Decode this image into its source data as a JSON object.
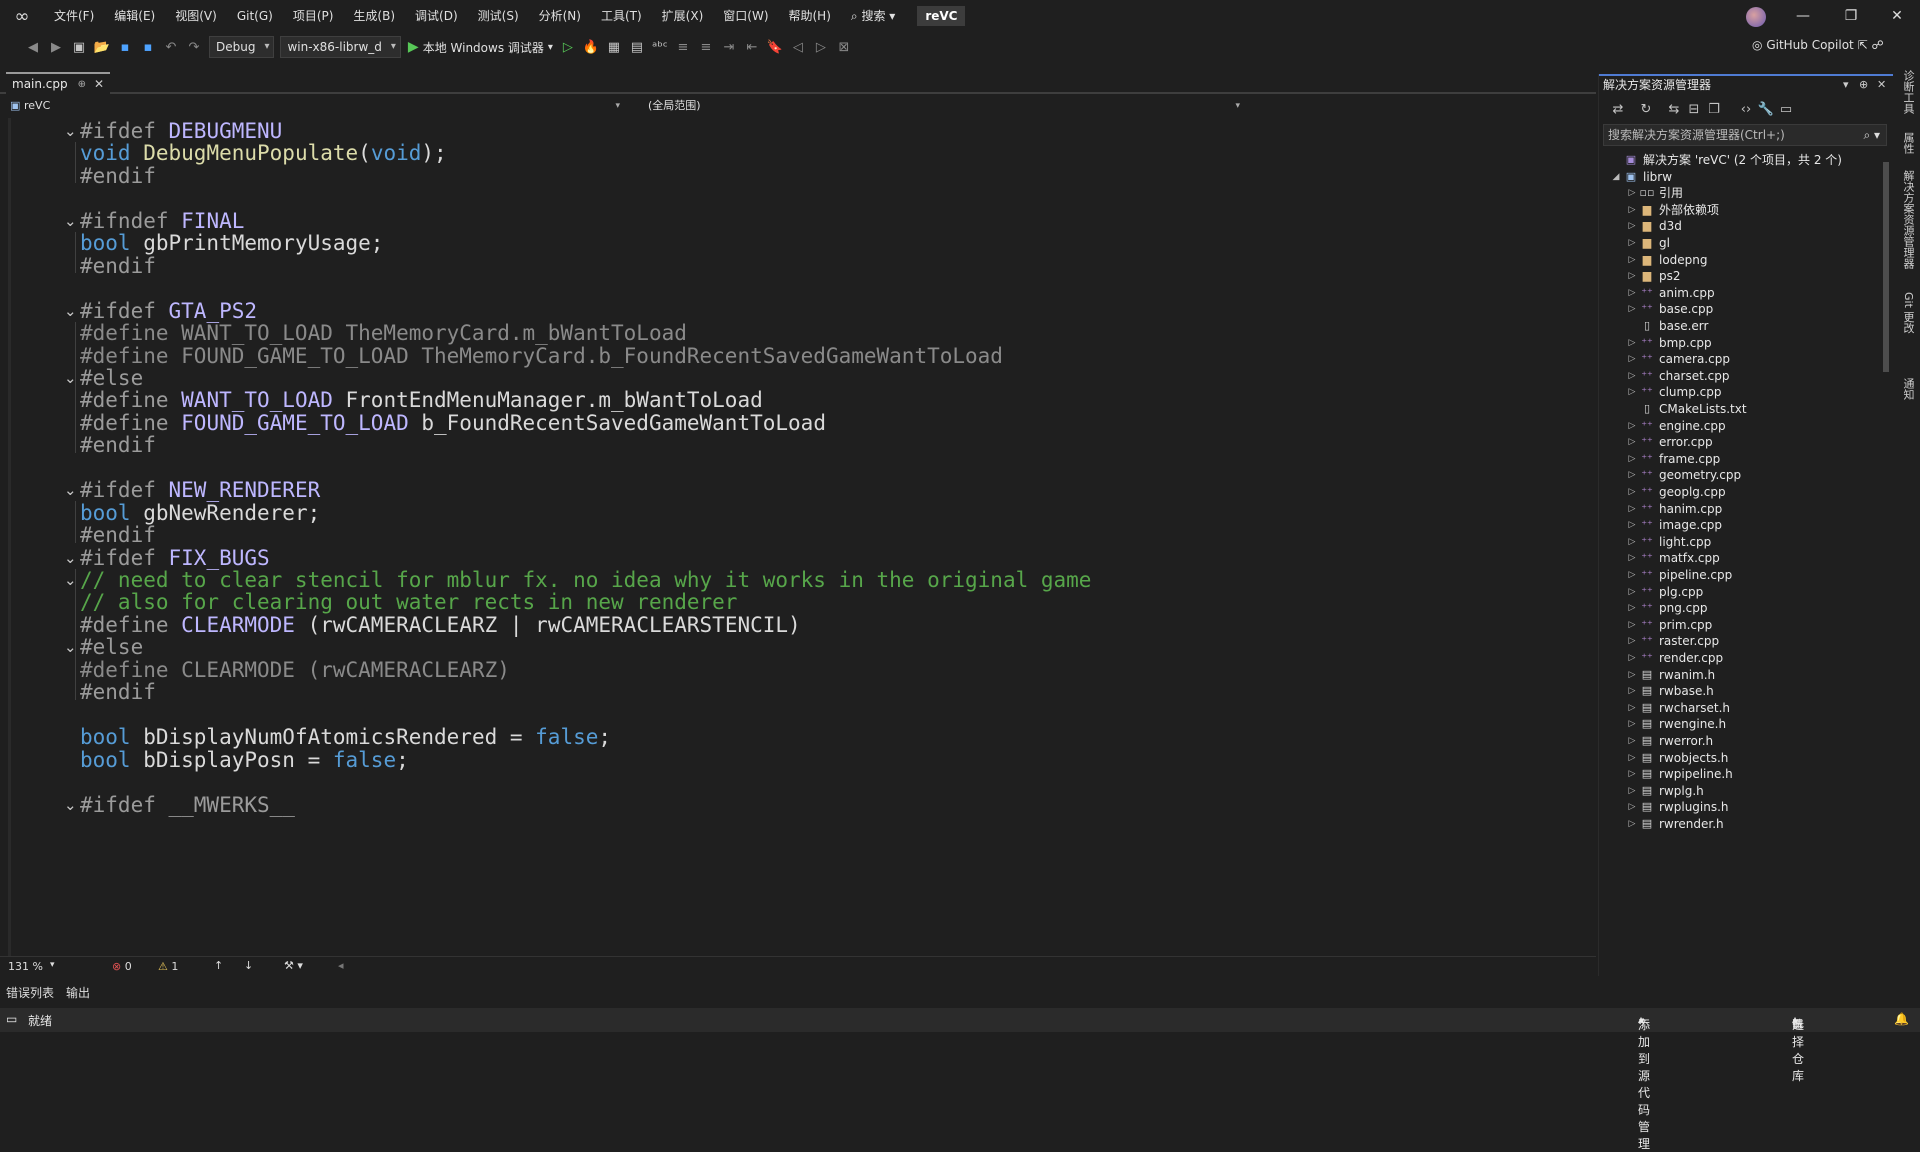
{
  "titlebar": {
    "menus": [
      "文件(F)",
      "编辑(E)",
      "视图(V)",
      "Git(G)",
      "项目(P)",
      "生成(B)",
      "调试(D)",
      "测试(S)",
      "分析(N)",
      "工具(T)",
      "扩展(X)",
      "窗口(W)",
      "帮助(H)"
    ],
    "search_label": "搜索",
    "solution_name": "reVC"
  },
  "toolbar": {
    "config": "Debug",
    "platform": "win-x86-librw_d",
    "run_label": "本地 Windows 调试器",
    "copilot_label": "GitHub Copilot"
  },
  "editor": {
    "tab_label": "main.cpp",
    "nav_project": "reVC",
    "nav_scope": "(全局范围)",
    "zoom": "131 %",
    "errors": "0",
    "warnings": "1"
  },
  "code_lines": [
    [
      "#ifdef ",
      "DEBUGMENU"
    ],
    [
      "void",
      " ",
      "DebugMenuPopulate",
      "(",
      "void",
      ");"
    ],
    [
      "#endif"
    ],
    [
      ""
    ],
    [
      "#ifndef ",
      "FINAL"
    ],
    [
      "bool",
      " gbPrintMemoryUsage;"
    ],
    [
      "#endif"
    ],
    [
      ""
    ],
    [
      "#ifdef ",
      "GTA_PS2"
    ],
    [
      "#define WANT_TO_LOAD TheMemoryCard.m_bWantToLoad"
    ],
    [
      "#define FOUND_GAME_TO_LOAD TheMemoryCard.b_FoundRecentSavedGameWantToLoad"
    ],
    [
      "#else"
    ],
    [
      "#define ",
      "WANT_TO_LOAD",
      " FrontEndMenuManager.m_bWantToLoad"
    ],
    [
      "#define ",
      "FOUND_GAME_TO_LOAD",
      " b_FoundRecentSavedGameWantToLoad"
    ],
    [
      "#endif"
    ],
    [
      ""
    ],
    [
      "#ifdef ",
      "NEW_RENDERER"
    ],
    [
      "bool",
      " gbNewRenderer;"
    ],
    [
      "#endif"
    ],
    [
      "#ifdef ",
      "FIX_BUGS"
    ],
    [
      "// need to clear stencil for mblur fx. no idea why it works in the original game"
    ],
    [
      "// also for clearing out water rects in new renderer"
    ],
    [
      "#define ",
      "CLEARMODE",
      " (rwCAMERACLEARZ | rwCAMERACLEARSTENCIL)"
    ],
    [
      "#else"
    ],
    [
      "#define CLEARMODE (rwCAMERACLEARZ)"
    ],
    [
      "#endif"
    ],
    [
      ""
    ],
    [
      "bool",
      " bDisplayNumOfAtomicsRendered = ",
      "false",
      ";"
    ],
    [
      "bool",
      " bDisplayPosn = ",
      "false",
      ";"
    ],
    [
      ""
    ],
    [
      "#ifdef __MWERKS__"
    ]
  ],
  "solution_explorer": {
    "title": "解决方案资源管理器",
    "search_placeholder": "搜索解决方案资源管理器(Ctrl+;)",
    "solution_label": "解决方案 'reVC' (2 个项目，共 2 个)",
    "project": "librw",
    "items": [
      {
        "label": "引用",
        "kind": "ref",
        "expand": true
      },
      {
        "label": "外部依赖项",
        "kind": "folder",
        "expand": true
      },
      {
        "label": "d3d",
        "kind": "folder",
        "expand": true
      },
      {
        "label": "gl",
        "kind": "folder",
        "expand": true
      },
      {
        "label": "lodepng",
        "kind": "folder",
        "expand": true
      },
      {
        "label": "ps2",
        "kind": "folder",
        "expand": true
      },
      {
        "label": "anim.cpp",
        "kind": "cpp",
        "expand": true
      },
      {
        "label": "base.cpp",
        "kind": "cpp",
        "expand": true
      },
      {
        "label": "base.err",
        "kind": "file",
        "expand": false
      },
      {
        "label": "bmp.cpp",
        "kind": "cpp",
        "expand": true
      },
      {
        "label": "camera.cpp",
        "kind": "cpp",
        "expand": true
      },
      {
        "label": "charset.cpp",
        "kind": "cpp",
        "expand": true
      },
      {
        "label": "clump.cpp",
        "kind": "cpp",
        "expand": true
      },
      {
        "label": "CMakeLists.txt",
        "kind": "file",
        "expand": false
      },
      {
        "label": "engine.cpp",
        "kind": "cpp",
        "expand": true
      },
      {
        "label": "error.cpp",
        "kind": "cpp",
        "expand": true
      },
      {
        "label": "frame.cpp",
        "kind": "cpp",
        "expand": true
      },
      {
        "label": "geometry.cpp",
        "kind": "cpp",
        "expand": true
      },
      {
        "label": "geoplg.cpp",
        "kind": "cpp",
        "expand": true
      },
      {
        "label": "hanim.cpp",
        "kind": "cpp",
        "expand": true
      },
      {
        "label": "image.cpp",
        "kind": "cpp",
        "expand": true
      },
      {
        "label": "light.cpp",
        "kind": "cpp",
        "expand": true
      },
      {
        "label": "matfx.cpp",
        "kind": "cpp",
        "expand": true
      },
      {
        "label": "pipeline.cpp",
        "kind": "cpp",
        "expand": true
      },
      {
        "label": "plg.cpp",
        "kind": "cpp",
        "expand": true
      },
      {
        "label": "png.cpp",
        "kind": "cpp",
        "expand": true
      },
      {
        "label": "prim.cpp",
        "kind": "cpp",
        "expand": true
      },
      {
        "label": "raster.cpp",
        "kind": "cpp",
        "expand": true
      },
      {
        "label": "render.cpp",
        "kind": "cpp",
        "expand": true
      },
      {
        "label": "rwanim.h",
        "kind": "h",
        "expand": true
      },
      {
        "label": "rwbase.h",
        "kind": "h",
        "expand": true
      },
      {
        "label": "rwcharset.h",
        "kind": "h",
        "expand": true
      },
      {
        "label": "rwengine.h",
        "kind": "h",
        "expand": true
      },
      {
        "label": "rwerror.h",
        "kind": "h",
        "expand": true
      },
      {
        "label": "rwobjects.h",
        "kind": "h",
        "expand": true
      },
      {
        "label": "rwpipeline.h",
        "kind": "h",
        "expand": true
      },
      {
        "label": "rwplg.h",
        "kind": "h",
        "expand": true
      },
      {
        "label": "rwplugins.h",
        "kind": "h",
        "expand": true
      },
      {
        "label": "rwrender.h",
        "kind": "h",
        "expand": true
      }
    ]
  },
  "side_tabs": [
    "诊断工具",
    "属性",
    "解决方案资源管理器",
    "Git 更改",
    "通知"
  ],
  "bottom_tabs": [
    "错误列表",
    "输出"
  ],
  "statusbar": {
    "ready": "就绪",
    "add_source": "添加到源代码管理",
    "select_repo": "选择仓库"
  }
}
